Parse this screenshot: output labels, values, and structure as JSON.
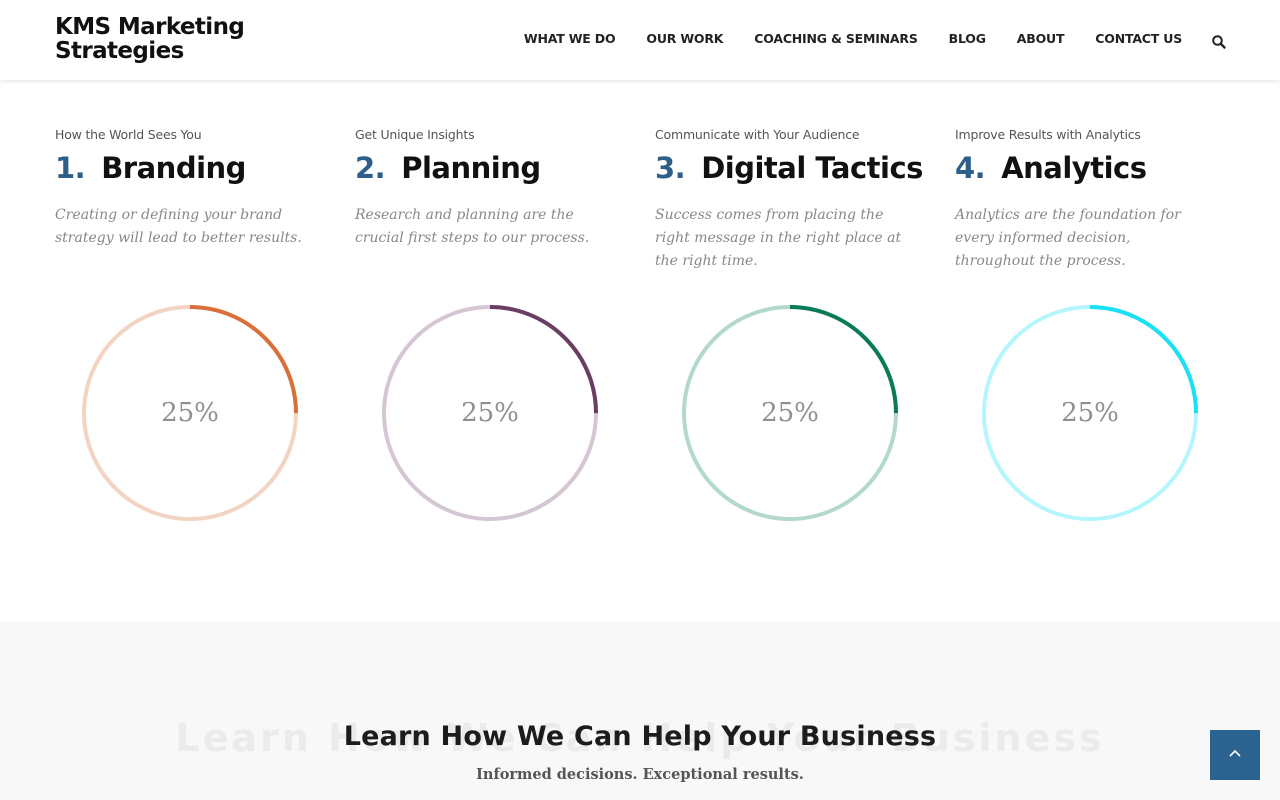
{
  "header": {
    "logo_line1": "KMS Marketing",
    "logo_line2": "Strategies",
    "nav": [
      "WHAT WE DO",
      "OUR WORK",
      "COACHING & SEMINARS",
      "BLOG",
      "ABOUT",
      "CONTACT US"
    ],
    "search_icon": "search-icon"
  },
  "steps": [
    {
      "kicker": "How the World Sees You",
      "number": "1.",
      "title": "Branding",
      "description": "Creating or defining your brand strategy will lead to better results.",
      "progress_label": "25%",
      "progress": 0.25,
      "color": "#d9703a",
      "track_color": "#f3d4c3"
    },
    {
      "kicker": "Get Unique Insights",
      "number": "2.",
      "title": "Planning",
      "description": "Research and planning are the crucial first steps to our process.",
      "progress_label": "25%",
      "progress": 0.25,
      "color": "#6a3d63",
      "track_color": "#d5c6d3"
    },
    {
      "kicker": "Communicate with Your Audience",
      "number": "3.",
      "title": "Digital Tactics",
      "description": "Success comes from placing the right message in the right place at the right time.",
      "progress_label": "25%",
      "progress": 0.25,
      "color": "#0a7a5a",
      "track_color": "#b3d9cc"
    },
    {
      "kicker": "Improve Results with Analytics",
      "number": "4.",
      "title": "Analytics",
      "description": "Analytics are the foundation for every informed decision, throughout the process.",
      "progress_label": "25%",
      "progress": 0.25,
      "color": "#19e0f5",
      "track_color": "#b5f6fd"
    }
  ],
  "cta": {
    "ghost_title": "Learn How We Can Help Your Business",
    "title": "Learn How We Can Help Your Business",
    "subtitle": "Informed decisions. Exceptional results."
  },
  "back_to_top_icon": "chevron-up-icon",
  "colors": {
    "accent": "#2e5f8a",
    "back_to_top": "#2a6290"
  }
}
